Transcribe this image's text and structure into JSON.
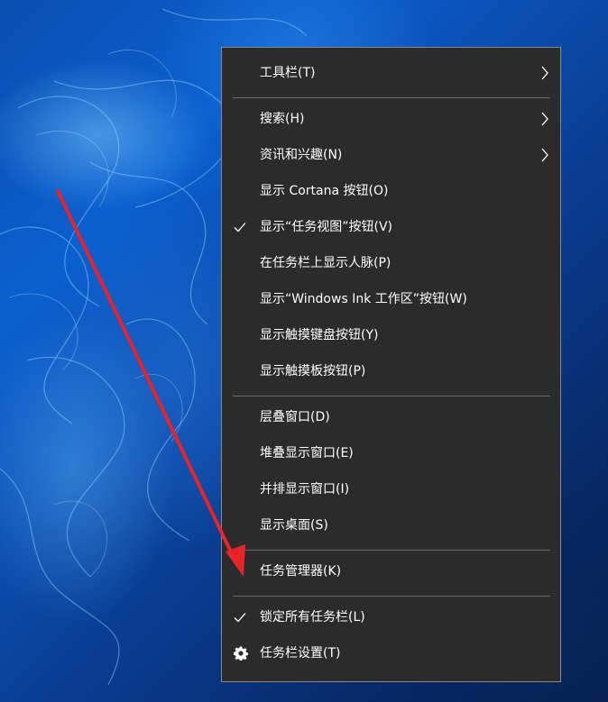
{
  "colors": {
    "menu_bg": "#2b2b2b",
    "menu_border": "#8a8a8a",
    "menu_text": "#ffffff",
    "separator": "#6b6b6b",
    "annotation_arrow": "#e8232a"
  },
  "menu": {
    "groups": [
      {
        "items": [
          {
            "label": "工具栏(T)",
            "submenu": true,
            "checked": false,
            "icon": null
          }
        ]
      },
      {
        "items": [
          {
            "label": "搜索(H)",
            "submenu": true,
            "checked": false,
            "icon": null
          },
          {
            "label": "资讯和兴趣(N)",
            "submenu": true,
            "checked": false,
            "icon": null
          },
          {
            "label": "显示 Cortana 按钮(O)",
            "submenu": false,
            "checked": false,
            "icon": null
          },
          {
            "label": "显示“任务视图”按钮(V)",
            "submenu": false,
            "checked": true,
            "icon": "check-icon"
          },
          {
            "label": "在任务栏上显示人脉(P)",
            "submenu": false,
            "checked": false,
            "icon": null
          },
          {
            "label": "显示“Windows Ink 工作区”按钮(W)",
            "submenu": false,
            "checked": false,
            "icon": null
          },
          {
            "label": "显示触摸键盘按钮(Y)",
            "submenu": false,
            "checked": false,
            "icon": null
          },
          {
            "label": "显示触摸板按钮(P)",
            "submenu": false,
            "checked": false,
            "icon": null
          }
        ]
      },
      {
        "items": [
          {
            "label": "层叠窗口(D)",
            "submenu": false,
            "checked": false,
            "icon": null
          },
          {
            "label": "堆叠显示窗口(E)",
            "submenu": false,
            "checked": false,
            "icon": null
          },
          {
            "label": "并排显示窗口(I)",
            "submenu": false,
            "checked": false,
            "icon": null
          },
          {
            "label": "显示桌面(S)",
            "submenu": false,
            "checked": false,
            "icon": null
          }
        ]
      },
      {
        "items": [
          {
            "label": "任务管理器(K)",
            "submenu": false,
            "checked": false,
            "icon": null
          }
        ]
      },
      {
        "items": [
          {
            "label": "锁定所有任务栏(L)",
            "submenu": false,
            "checked": true,
            "icon": "check-icon"
          },
          {
            "label": "任务栏设置(T)",
            "submenu": false,
            "checked": false,
            "icon": "gear-icon"
          }
        ]
      }
    ]
  }
}
